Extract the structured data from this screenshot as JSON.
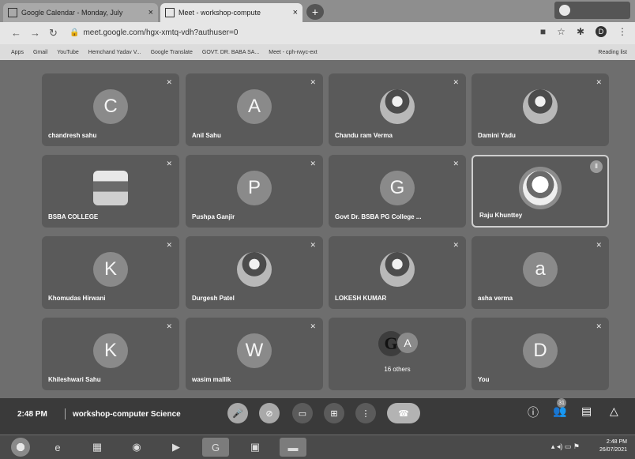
{
  "browser": {
    "tabs": [
      {
        "title": "Google Calendar - Monday, July",
        "close": "×"
      },
      {
        "title": "Meet - workshop-compute",
        "close": "×"
      }
    ],
    "new_tab": "+",
    "url": "meet.google.com/hgx-xmtq-vdh?authuser=0",
    "bookmarks": [
      "Apps",
      "Gmail",
      "YouTube",
      "Hemchand Yadav V...",
      "Google Translate",
      "GOVT. DR. BABA SA...",
      "Meet - cph-rwyc-ext"
    ],
    "reading_list": "Reading list",
    "profile_initial": "D"
  },
  "participants": [
    {
      "name": "chandresh sahu",
      "initial": "C",
      "type": "letter"
    },
    {
      "name": "Anil Sahu",
      "initial": "A",
      "type": "letter"
    },
    {
      "name": "Chandu ram Verma",
      "initial": "",
      "type": "photo"
    },
    {
      "name": "Damini Yadu",
      "initial": "",
      "type": "photo"
    },
    {
      "name": "BSBA COLLEGE",
      "initial": "",
      "type": "college"
    },
    {
      "name": "Pushpa Ganjir",
      "initial": "P",
      "type": "letter"
    },
    {
      "name": "Govt Dr. BSBA PG College ...",
      "initial": "G",
      "type": "letter"
    },
    {
      "name": "Raju Khunttey",
      "initial": "",
      "type": "speaking"
    },
    {
      "name": "Khomudas Hirwani",
      "initial": "K",
      "type": "letter"
    },
    {
      "name": "Durgesh Patel",
      "initial": "",
      "type": "photo"
    },
    {
      "name": "LOKESH KUMAR",
      "initial": "",
      "type": "photo"
    },
    {
      "name": "asha verma",
      "initial": "a",
      "type": "letter"
    },
    {
      "name": "Khileshwari Sahu",
      "initial": "K",
      "type": "letter"
    },
    {
      "name": "wasim mallik",
      "initial": "W",
      "type": "letter"
    },
    {
      "name": "16 others",
      "initial": "A",
      "type": "others",
      "logo": "G"
    },
    {
      "name": "You",
      "initial": "D",
      "type": "letter"
    }
  ],
  "controls": {
    "time": "2:48 PM",
    "meeting_name": "workshop-computer Science",
    "people_count": "31"
  },
  "taskbar": {
    "time": "2:48 PM",
    "date": "26/07/2021"
  },
  "icons": [
    "mic-off-icon",
    "camera-off-icon",
    "captions-icon",
    "present-icon",
    "more-icon",
    "end-call-icon",
    "info-icon",
    "people-icon",
    "chat-icon",
    "activities-icon"
  ]
}
